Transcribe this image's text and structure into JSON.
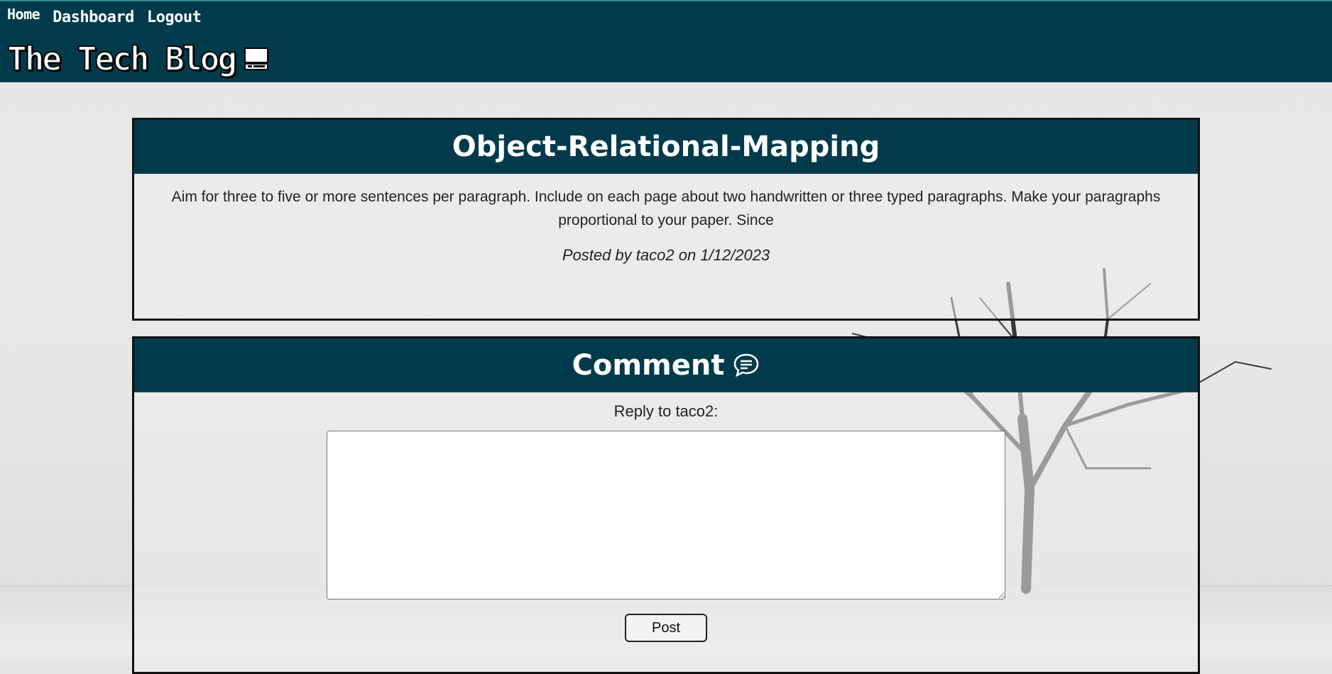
{
  "nav": {
    "home": "Home",
    "dashboard": "Dashboard",
    "logout": "Logout"
  },
  "brand": {
    "title": "The Tech Blog",
    "icon": "computer-icon"
  },
  "post": {
    "title": "Object-Relational-Mapping",
    "content": "Aim for three to five or more sentences per paragraph. Include on each page about two handwritten or three typed paragraphs. Make your paragraphs proportional to your paper. Since",
    "meta": "Posted by taco2 on 1/12/2023"
  },
  "comment": {
    "title": "Comment",
    "icon": "speech-bubble-icon",
    "reply_label": "Reply to taco2:",
    "textarea_value": "",
    "post_button": "Post"
  },
  "colors": {
    "header_bg": "#013b4b",
    "card_border": "#111111"
  }
}
